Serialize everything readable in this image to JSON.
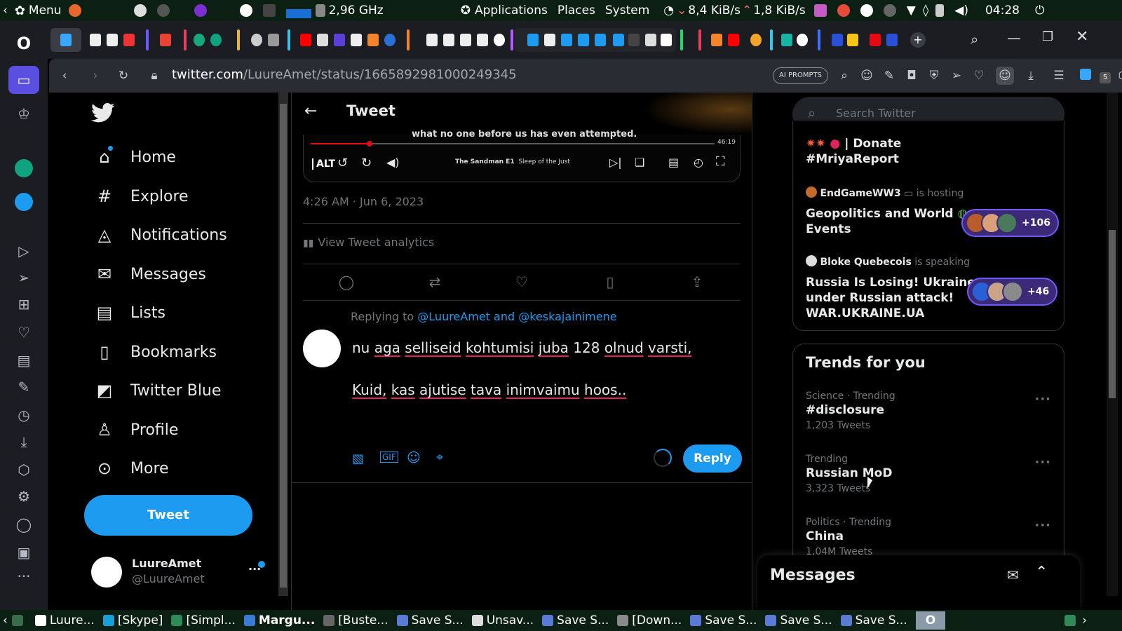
{
  "system_panel": {
    "menu_label": "Menu",
    "cpu": "2,96 GHz",
    "applications": "Applications",
    "places": "Places",
    "system": "System",
    "down_rate": "8,4 KiB/s",
    "up_rate": "1,8 KiB/s",
    "clock": "04:28"
  },
  "browser": {
    "url_host": "twitter.com",
    "url_path": "/LuureAmet/status/1665892981000249345",
    "ai_prompts": "AI PROMPTS",
    "tab_badge": "5"
  },
  "left_nav": {
    "items": [
      {
        "label": "Home",
        "icon": "home-icon"
      },
      {
        "label": "Explore",
        "icon": "hashtag-icon"
      },
      {
        "label": "Notifications",
        "icon": "bell-icon"
      },
      {
        "label": "Messages",
        "icon": "envelope-icon"
      },
      {
        "label": "Lists",
        "icon": "list-icon"
      },
      {
        "label": "Bookmarks",
        "icon": "bookmark-icon"
      },
      {
        "label": "Twitter Blue",
        "icon": "twitter-blue-icon"
      },
      {
        "label": "Profile",
        "icon": "person-icon"
      },
      {
        "label": "More",
        "icon": "more-circle-icon"
      }
    ],
    "tweet_button": "Tweet",
    "account_name": "LuureAmet",
    "account_handle": "@LuureAmet"
  },
  "tweet_view": {
    "header_title": "Tweet",
    "video_caption": "what no one before us has even attempted.",
    "video_time": "46:19",
    "video_alt": "ALT",
    "video_title": "The Sandman E1",
    "video_episode": "Sleep of the Just",
    "timestamp": "4:26 AM · Jun 6, 2023",
    "analytics": "View Tweet analytics",
    "replying_to_prefix": "Replying to",
    "replying_to": "@LuureAmet and @keskajainimene",
    "reply_line1_words": [
      "nu",
      "aga",
      "selliseid",
      "kohtumisi",
      "juba",
      "128",
      "olnud",
      "varsti,"
    ],
    "reply_line1_underlined": [
      false,
      true,
      true,
      true,
      true,
      false,
      true,
      true
    ],
    "reply_line2_words": [
      "Kuid,",
      "kas",
      "ajutise",
      "tava",
      "inimvaimu",
      "hoos.."
    ],
    "reply_button": "Reply"
  },
  "right_col": {
    "search_placeholder": "Search Twitter",
    "spaces": {
      "top_title_line1": "| Donate",
      "top_title_line2": "#MriyaReport",
      "space1": {
        "host": "EndGameWW3",
        "verb": "is hosting",
        "title_line1": "Geopolitics and World",
        "title_line2": "Events",
        "listeners": "+106"
      },
      "space2": {
        "host": "Bloke Quebecois",
        "verb": "is speaking",
        "title_line1": "Russia Is Losing! Ukraine",
        "title_line2": "under Russian attack!",
        "title_line3": "WAR.UKRAINE.UA",
        "listeners": "+46"
      }
    },
    "trends_title": "Trends for you",
    "trends": [
      {
        "category": "Science · Trending",
        "name": "#disclosure",
        "count": "1,203 Tweets"
      },
      {
        "category": "Trending",
        "name": "Russian MoD",
        "count": "3,323 Tweets"
      },
      {
        "category": "Politics · Trending",
        "name": "China",
        "count": "1,04M Tweets"
      }
    ],
    "messages_label": "Messages"
  },
  "taskbar": {
    "tasks": [
      "Luure...",
      "[Skype]",
      "[Simpl...",
      "Margu...",
      "[Buste...",
      "Save S...",
      "Unsav...",
      "Save S...",
      "[Down...",
      "Save S...",
      "Save S...",
      "Save S..."
    ]
  },
  "colors": {
    "twitter_blue": "#1d9bf0",
    "panel_green": "#0c1f13",
    "browser_dark": "#1c1d22",
    "spaces_purple": "#7856ff"
  }
}
